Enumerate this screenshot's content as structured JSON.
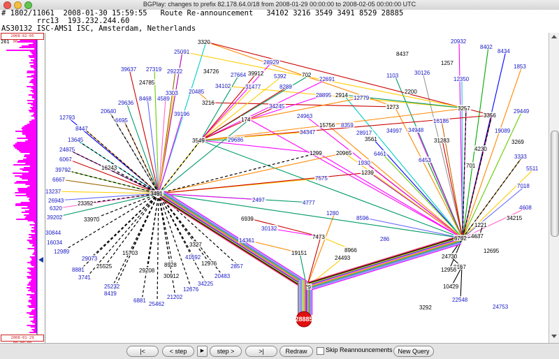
{
  "window": {
    "title": "BGPlay: changes to prefix 82.178.64.0/18 from 2008-01-29 00:00:00 to 2008-02-05 00:00:00 UTC"
  },
  "info": {
    "line1": "# 1802/11061  2008-01-30 15:59:55   Route Re-announcement   34102 3216 3549 3491 8529 28885",
    "line2": "        rrc13  193.232.244.60",
    "line3": "AS30132 ISC-AMS1 ISC, Amsterdam, Netherlands"
  },
  "timeline": {
    "top_label": "2008-02-05 00:00:00",
    "count": "261",
    "bottom_label": "2008-01-29 00:00:00",
    "marker_fraction": 0.74
  },
  "controls": {
    "first": "|<",
    "prev_step": "< step",
    "play": "▶",
    "next_step": "step >",
    "last": ">|",
    "redraw": "Redraw",
    "skip_label": "Skip Reannouncements",
    "new_query": "New Query"
  },
  "graph": {
    "origin": "28885",
    "colors": {
      "blue_label": "#1a1ac8",
      "black_label": "#000000",
      "origin_fill": "#e01010"
    }
  }
}
